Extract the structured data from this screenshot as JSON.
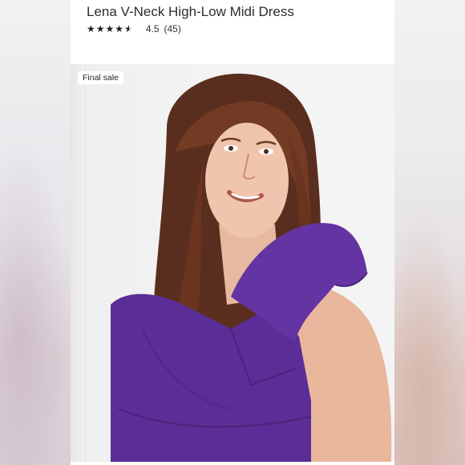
{
  "product": {
    "title": "Lena V-Neck High-Low Midi Dress",
    "rating": {
      "value": "4.5",
      "count": "(45)",
      "stars_filled": 4.5,
      "stars_total": 5
    }
  },
  "image": {
    "badge": "Final sale",
    "subject": "model-in-purple-flutter-sleeve-dress"
  },
  "colors": {
    "dress": "#5b2d96",
    "background": "#f3f3f3",
    "text": "#2d2d2d"
  },
  "icons": [
    "star-icon",
    "star-half-icon"
  ]
}
